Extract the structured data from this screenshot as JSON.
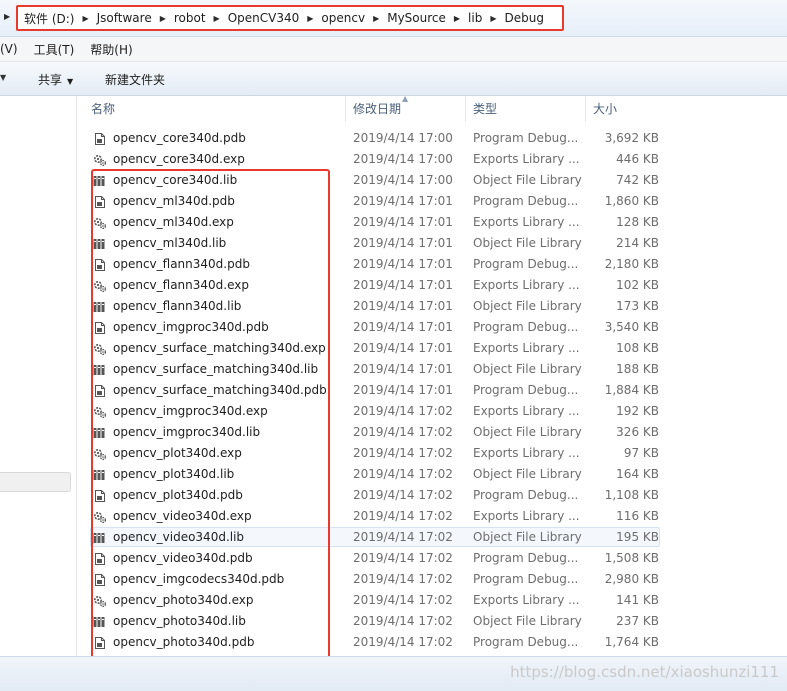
{
  "address_bar": {
    "crumbs": [
      "软件 (D:)",
      "Jsoftware",
      "robot",
      "OpenCV340",
      "opencv",
      "MySource",
      "lib",
      "Debug"
    ],
    "highlight_color": "#e8392e"
  },
  "menu": {
    "items": [
      "(V)",
      "工具(T)",
      "帮助(H)"
    ]
  },
  "toolbar": {
    "share_label": "共享",
    "new_folder_label": "新建文件夹"
  },
  "columns": {
    "name": "名称",
    "date": "修改日期",
    "type": "类型",
    "size": "大小"
  },
  "files": [
    {
      "name": "opencv_core340d.pdb",
      "date": "2019/4/14 17:00",
      "type": "Program Debug...",
      "size": "3,692 KB",
      "icon": "pdb-file-icon"
    },
    {
      "name": "opencv_core340d.exp",
      "date": "2019/4/14 17:00",
      "type": "Exports Library ...",
      "size": "446 KB",
      "icon": "exp-file-icon"
    },
    {
      "name": "opencv_core340d.lib",
      "date": "2019/4/14 17:00",
      "type": "Object File Library",
      "size": "742 KB",
      "icon": "lib-file-icon"
    },
    {
      "name": "opencv_ml340d.pdb",
      "date": "2019/4/14 17:01",
      "type": "Program Debug...",
      "size": "1,860 KB",
      "icon": "pdb-file-icon"
    },
    {
      "name": "opencv_ml340d.exp",
      "date": "2019/4/14 17:01",
      "type": "Exports Library ...",
      "size": "128 KB",
      "icon": "exp-file-icon"
    },
    {
      "name": "opencv_ml340d.lib",
      "date": "2019/4/14 17:01",
      "type": "Object File Library",
      "size": "214 KB",
      "icon": "lib-file-icon"
    },
    {
      "name": "opencv_flann340d.pdb",
      "date": "2019/4/14 17:01",
      "type": "Program Debug...",
      "size": "2,180 KB",
      "icon": "pdb-file-icon"
    },
    {
      "name": "opencv_flann340d.exp",
      "date": "2019/4/14 17:01",
      "type": "Exports Library ...",
      "size": "102 KB",
      "icon": "exp-file-icon"
    },
    {
      "name": "opencv_flann340d.lib",
      "date": "2019/4/14 17:01",
      "type": "Object File Library",
      "size": "173 KB",
      "icon": "lib-file-icon"
    },
    {
      "name": "opencv_imgproc340d.pdb",
      "date": "2019/4/14 17:01",
      "type": "Program Debug...",
      "size": "3,540 KB",
      "icon": "pdb-file-icon"
    },
    {
      "name": "opencv_surface_matching340d.exp",
      "date": "2019/4/14 17:01",
      "type": "Exports Library ...",
      "size": "108 KB",
      "icon": "exp-file-icon"
    },
    {
      "name": "opencv_surface_matching340d.lib",
      "date": "2019/4/14 17:01",
      "type": "Object File Library",
      "size": "188 KB",
      "icon": "lib-file-icon"
    },
    {
      "name": "opencv_surface_matching340d.pdb",
      "date": "2019/4/14 17:01",
      "type": "Program Debug...",
      "size": "1,884 KB",
      "icon": "pdb-file-icon"
    },
    {
      "name": "opencv_imgproc340d.exp",
      "date": "2019/4/14 17:02",
      "type": "Exports Library ...",
      "size": "192 KB",
      "icon": "exp-file-icon"
    },
    {
      "name": "opencv_imgproc340d.lib",
      "date": "2019/4/14 17:02",
      "type": "Object File Library",
      "size": "326 KB",
      "icon": "lib-file-icon"
    },
    {
      "name": "opencv_plot340d.exp",
      "date": "2019/4/14 17:02",
      "type": "Exports Library ...",
      "size": "97 KB",
      "icon": "exp-file-icon"
    },
    {
      "name": "opencv_plot340d.lib",
      "date": "2019/4/14 17:02",
      "type": "Object File Library",
      "size": "164 KB",
      "icon": "lib-file-icon"
    },
    {
      "name": "opencv_plot340d.pdb",
      "date": "2019/4/14 17:02",
      "type": "Program Debug...",
      "size": "1,108 KB",
      "icon": "pdb-file-icon"
    },
    {
      "name": "opencv_video340d.exp",
      "date": "2019/4/14 17:02",
      "type": "Exports Library ...",
      "size": "116 KB",
      "icon": "exp-file-icon"
    },
    {
      "name": "opencv_video340d.lib",
      "date": "2019/4/14 17:02",
      "type": "Object File Library",
      "size": "195 KB",
      "icon": "lib-file-icon",
      "selected": true
    },
    {
      "name": "opencv_video340d.pdb",
      "date": "2019/4/14 17:02",
      "type": "Program Debug...",
      "size": "1,508 KB",
      "icon": "pdb-file-icon"
    },
    {
      "name": "opencv_imgcodecs340d.pdb",
      "date": "2019/4/14 17:02",
      "type": "Program Debug...",
      "size": "2,980 KB",
      "icon": "pdb-file-icon"
    },
    {
      "name": "opencv_photo340d.exp",
      "date": "2019/4/14 17:02",
      "type": "Exports Library ...",
      "size": "141 KB",
      "icon": "exp-file-icon"
    },
    {
      "name": "opencv_photo340d.lib",
      "date": "2019/4/14 17:02",
      "type": "Object File Library",
      "size": "237 KB",
      "icon": "lib-file-icon"
    },
    {
      "name": "opencv_photo340d.pdb",
      "date": "2019/4/14 17:02",
      "type": "Program Debug...",
      "size": "1,764 KB",
      "icon": "pdb-file-icon"
    }
  ],
  "watermark": "https://blog.csdn.net/xiaoshunzi111"
}
